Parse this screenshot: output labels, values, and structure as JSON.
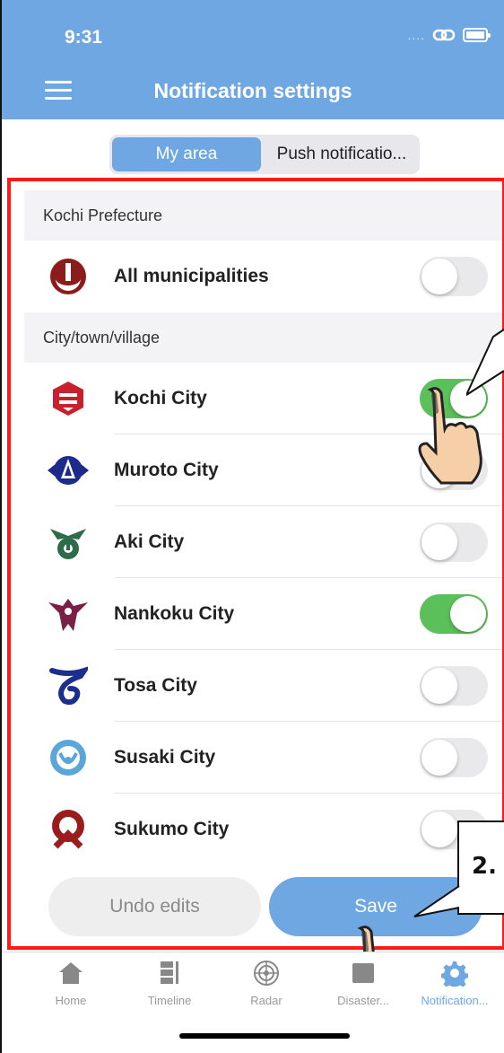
{
  "status_bar": {
    "time": "9:31",
    "signal_dots": "...."
  },
  "header": {
    "title": "Notification settings"
  },
  "segment": {
    "tabs": [
      "My area",
      "Push notificatio..."
    ],
    "active_index": 0
  },
  "sections": {
    "prefecture": "Kochi Prefecture",
    "municipal": "City/town/village"
  },
  "rows": [
    {
      "label": "All municipalities",
      "icon": "kochi-prefecture-emblem-icon",
      "enabled": false
    },
    {
      "label": "Kochi City",
      "icon": "kochi-city-emblem-icon",
      "enabled": true
    },
    {
      "label": "Muroto City",
      "icon": "muroto-city-emblem-icon",
      "enabled": false
    },
    {
      "label": "Aki City",
      "icon": "aki-city-emblem-icon",
      "enabled": false
    },
    {
      "label": "Nankoku City",
      "icon": "nankoku-city-emblem-icon",
      "enabled": true
    },
    {
      "label": "Tosa City",
      "icon": "tosa-city-emblem-icon",
      "enabled": false
    },
    {
      "label": "Susaki City",
      "icon": "susaki-city-emblem-icon",
      "enabled": false
    },
    {
      "label": "Sukumo City",
      "icon": "sukumo-city-emblem-icon",
      "enabled": false
    }
  ],
  "buttons": {
    "undo": "Undo edits",
    "save": "Save"
  },
  "annotation": {
    "step_label": "2."
  },
  "tabbar": {
    "tabs": [
      {
        "label": "Home",
        "icon": "home-icon"
      },
      {
        "label": "Timeline",
        "icon": "timeline-icon"
      },
      {
        "label": "Radar",
        "icon": "radar-icon"
      },
      {
        "label": "Disaster...",
        "icon": "disaster-icon"
      },
      {
        "label": "Notification...",
        "icon": "gear-icon"
      }
    ],
    "active_index": 4
  },
  "colors": {
    "accent": "#6ea7e2",
    "toggle_on": "#5bbf5a",
    "highlight": "#ff1a1a"
  }
}
